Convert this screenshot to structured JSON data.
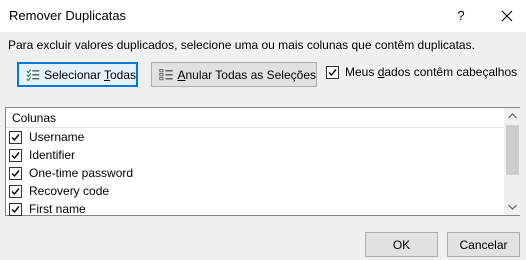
{
  "dialog": {
    "title": "Remover Duplicatas",
    "help_label": "?",
    "instructions": "Para excluir valores duplicados, selecione uma ou mais colunas que contêm duplicatas."
  },
  "buttons": {
    "select_all": {
      "prefix": "Selecionar ",
      "accel": "T",
      "suffix": "odas"
    },
    "deselect_all": {
      "prefix": "",
      "accel": "A",
      "suffix": "nular Todas as Seleções"
    },
    "ok": "OK",
    "cancel": "Cancelar"
  },
  "header_checkbox": {
    "prefix": "Meus ",
    "accel": "d",
    "suffix": "ados contêm cabeçalhos",
    "checked": true
  },
  "columns_list": {
    "header": "Colunas",
    "items": [
      {
        "label": "Username",
        "checked": true
      },
      {
        "label": "Identifier",
        "checked": true
      },
      {
        "label": "One-time password",
        "checked": true
      },
      {
        "label": "Recovery code",
        "checked": true
      },
      {
        "label": "First name",
        "checked": true
      }
    ]
  },
  "icons": {
    "select_all": "checklist-icon",
    "deselect_all": "list-icon",
    "close": "close-icon",
    "checkbox_check": "check-icon"
  },
  "colors": {
    "focus_border": "#0078d7",
    "focus_fill": "#e5f1fb",
    "checklist_green": "#2e8b2e"
  }
}
